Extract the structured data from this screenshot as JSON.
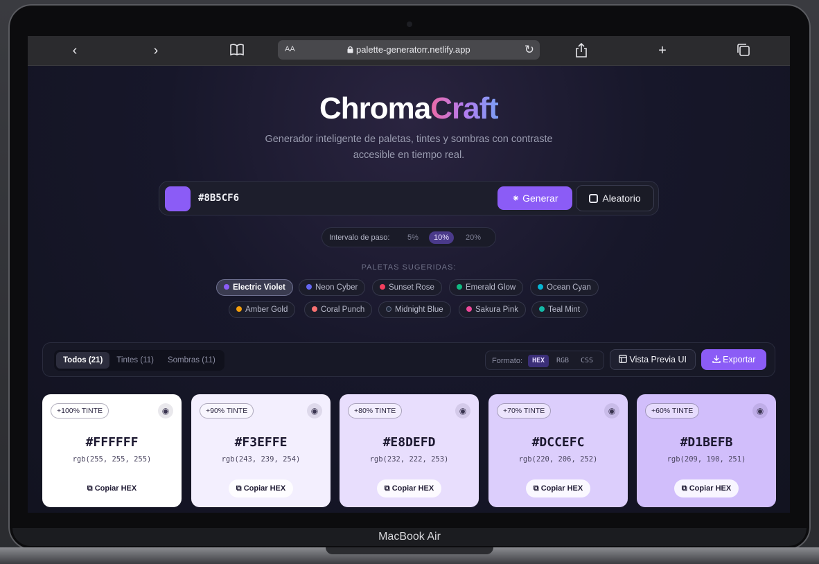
{
  "device": {
    "label": "MacBook Air"
  },
  "browser": {
    "aa_label": "AA",
    "url": "palette-generatorr.netlify.app",
    "icons": [
      "back-icon",
      "forward-icon",
      "bookmarks-icon",
      "lock-icon",
      "reload-icon",
      "share-icon",
      "new-tab-icon",
      "tabs-icon"
    ]
  },
  "header": {
    "title_part1": "Chroma",
    "title_part2": "Craft",
    "subtitle_line1": "Generador inteligente de paletas, tintes y sombras con contraste",
    "subtitle_line2": "accesible en tiempo real."
  },
  "input": {
    "color": "#8B5CF6",
    "value": "#8B5CF6",
    "generate_label": "Generar",
    "random_label": "Aleatorio"
  },
  "step": {
    "label": "Intervalo de paso:",
    "options": [
      "5%",
      "10%",
      "20%"
    ],
    "active": "10%"
  },
  "suggested": {
    "heading": "PALETAS SUGERIDAS:",
    "chips": [
      {
        "label": "Electric Violet",
        "color": "#8B5CF6",
        "active": true
      },
      {
        "label": "Neon Cyber",
        "color": "#6366F1"
      },
      {
        "label": "Sunset Rose",
        "color": "#F43F5E"
      },
      {
        "label": "Emerald Glow",
        "color": "#10B981"
      },
      {
        "label": "Ocean Cyan",
        "color": "#06B6D4"
      },
      {
        "label": "Amber Gold",
        "color": "#F59E0B"
      },
      {
        "label": "Coral Punch",
        "color": "#F87171"
      },
      {
        "label": "Midnight Blue",
        "color": "#1E293B"
      },
      {
        "label": "Sakura Pink",
        "color": "#EC4899"
      },
      {
        "label": "Teal Mint",
        "color": "#14B8A6"
      }
    ]
  },
  "toolbar": {
    "tabs": [
      "Todos (21)",
      "Tintes (11)",
      "Sombras (11)"
    ],
    "format_label": "Formato:",
    "formats": [
      "HEX",
      "RGB",
      "CSS"
    ],
    "active_format": "HEX",
    "preview_label": "Vista Previa UI",
    "export_label": "Exportar"
  },
  "cards": [
    {
      "badge": "+100% TINTE",
      "hex": "#FFFFFF",
      "rgb": "rgb(255, 255, 255)",
      "copy": "Copiar HEX",
      "bg": "#FFFFFF"
    },
    {
      "badge": "+90% TINTE",
      "hex": "#F3EFFE",
      "rgb": "rgb(243, 239, 254)",
      "copy": "Copiar HEX",
      "bg": "#F3EFFE"
    },
    {
      "badge": "+80% TINTE",
      "hex": "#E8DEFD",
      "rgb": "rgb(232, 222, 253)",
      "copy": "Copiar HEX",
      "bg": "#E8DEFD"
    },
    {
      "badge": "+70% TINTE",
      "hex": "#DCCEFC",
      "rgb": "rgb(220, 206, 252)",
      "copy": "Copiar HEX",
      "bg": "#DCCEFC"
    },
    {
      "badge": "+60% TINTE",
      "hex": "#D1BEFB",
      "rgb": "rgb(209, 190, 251)",
      "copy": "Copiar HEX",
      "bg": "#D1BEFB"
    }
  ]
}
